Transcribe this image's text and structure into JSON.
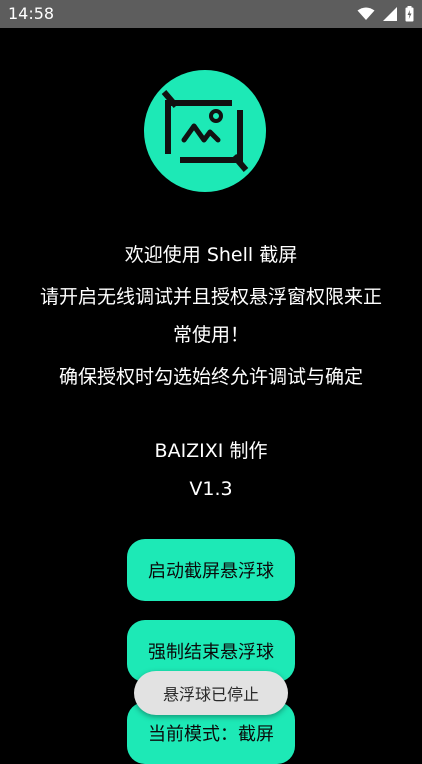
{
  "status_bar": {
    "time": "14:58",
    "icons": [
      "wifi-icon",
      "signal-icon",
      "battery-icon"
    ]
  },
  "logo": {
    "icon": "image-frame-logo-icon",
    "color": "#1de9b6"
  },
  "intro": {
    "welcome": "欢迎使用 Shell 截屏",
    "instruction_line1": "请开启无线调试并且授权悬浮窗权限来正",
    "instruction_line2": "常使用！",
    "confirm": "确保授权时勾选始终允许调试与确定"
  },
  "credits": {
    "author": "BAIZIXI 制作",
    "version": "V1.3"
  },
  "buttons": {
    "start": "启动截屏悬浮球",
    "force_stop": "强制结束悬浮球",
    "mode": "当前模式：截屏"
  },
  "toast": {
    "message": "悬浮球已停止"
  },
  "colors": {
    "accent": "#1de9b6",
    "background": "#000000",
    "status_bar": "#5d5d5d"
  }
}
